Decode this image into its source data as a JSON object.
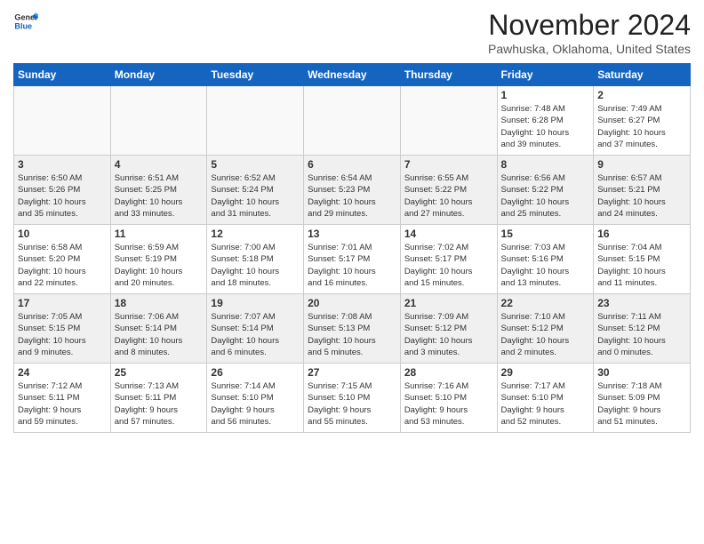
{
  "header": {
    "logo_general": "General",
    "logo_blue": "Blue",
    "title": "November 2024",
    "location": "Pawhuska, Oklahoma, United States"
  },
  "weekdays": [
    "Sunday",
    "Monday",
    "Tuesday",
    "Wednesday",
    "Thursday",
    "Friday",
    "Saturday"
  ],
  "weeks": [
    [
      {
        "day": "",
        "info": ""
      },
      {
        "day": "",
        "info": ""
      },
      {
        "day": "",
        "info": ""
      },
      {
        "day": "",
        "info": ""
      },
      {
        "day": "",
        "info": ""
      },
      {
        "day": "1",
        "info": "Sunrise: 7:48 AM\nSunset: 6:28 PM\nDaylight: 10 hours\nand 39 minutes."
      },
      {
        "day": "2",
        "info": "Sunrise: 7:49 AM\nSunset: 6:27 PM\nDaylight: 10 hours\nand 37 minutes."
      }
    ],
    [
      {
        "day": "3",
        "info": "Sunrise: 6:50 AM\nSunset: 5:26 PM\nDaylight: 10 hours\nand 35 minutes."
      },
      {
        "day": "4",
        "info": "Sunrise: 6:51 AM\nSunset: 5:25 PM\nDaylight: 10 hours\nand 33 minutes."
      },
      {
        "day": "5",
        "info": "Sunrise: 6:52 AM\nSunset: 5:24 PM\nDaylight: 10 hours\nand 31 minutes."
      },
      {
        "day": "6",
        "info": "Sunrise: 6:54 AM\nSunset: 5:23 PM\nDaylight: 10 hours\nand 29 minutes."
      },
      {
        "day": "7",
        "info": "Sunrise: 6:55 AM\nSunset: 5:22 PM\nDaylight: 10 hours\nand 27 minutes."
      },
      {
        "day": "8",
        "info": "Sunrise: 6:56 AM\nSunset: 5:22 PM\nDaylight: 10 hours\nand 25 minutes."
      },
      {
        "day": "9",
        "info": "Sunrise: 6:57 AM\nSunset: 5:21 PM\nDaylight: 10 hours\nand 24 minutes."
      }
    ],
    [
      {
        "day": "10",
        "info": "Sunrise: 6:58 AM\nSunset: 5:20 PM\nDaylight: 10 hours\nand 22 minutes."
      },
      {
        "day": "11",
        "info": "Sunrise: 6:59 AM\nSunset: 5:19 PM\nDaylight: 10 hours\nand 20 minutes."
      },
      {
        "day": "12",
        "info": "Sunrise: 7:00 AM\nSunset: 5:18 PM\nDaylight: 10 hours\nand 18 minutes."
      },
      {
        "day": "13",
        "info": "Sunrise: 7:01 AM\nSunset: 5:17 PM\nDaylight: 10 hours\nand 16 minutes."
      },
      {
        "day": "14",
        "info": "Sunrise: 7:02 AM\nSunset: 5:17 PM\nDaylight: 10 hours\nand 15 minutes."
      },
      {
        "day": "15",
        "info": "Sunrise: 7:03 AM\nSunset: 5:16 PM\nDaylight: 10 hours\nand 13 minutes."
      },
      {
        "day": "16",
        "info": "Sunrise: 7:04 AM\nSunset: 5:15 PM\nDaylight: 10 hours\nand 11 minutes."
      }
    ],
    [
      {
        "day": "17",
        "info": "Sunrise: 7:05 AM\nSunset: 5:15 PM\nDaylight: 10 hours\nand 9 minutes."
      },
      {
        "day": "18",
        "info": "Sunrise: 7:06 AM\nSunset: 5:14 PM\nDaylight: 10 hours\nand 8 minutes."
      },
      {
        "day": "19",
        "info": "Sunrise: 7:07 AM\nSunset: 5:14 PM\nDaylight: 10 hours\nand 6 minutes."
      },
      {
        "day": "20",
        "info": "Sunrise: 7:08 AM\nSunset: 5:13 PM\nDaylight: 10 hours\nand 5 minutes."
      },
      {
        "day": "21",
        "info": "Sunrise: 7:09 AM\nSunset: 5:12 PM\nDaylight: 10 hours\nand 3 minutes."
      },
      {
        "day": "22",
        "info": "Sunrise: 7:10 AM\nSunset: 5:12 PM\nDaylight: 10 hours\nand 2 minutes."
      },
      {
        "day": "23",
        "info": "Sunrise: 7:11 AM\nSunset: 5:12 PM\nDaylight: 10 hours\nand 0 minutes."
      }
    ],
    [
      {
        "day": "24",
        "info": "Sunrise: 7:12 AM\nSunset: 5:11 PM\nDaylight: 9 hours\nand 59 minutes."
      },
      {
        "day": "25",
        "info": "Sunrise: 7:13 AM\nSunset: 5:11 PM\nDaylight: 9 hours\nand 57 minutes."
      },
      {
        "day": "26",
        "info": "Sunrise: 7:14 AM\nSunset: 5:10 PM\nDaylight: 9 hours\nand 56 minutes."
      },
      {
        "day": "27",
        "info": "Sunrise: 7:15 AM\nSunset: 5:10 PM\nDaylight: 9 hours\nand 55 minutes."
      },
      {
        "day": "28",
        "info": "Sunrise: 7:16 AM\nSunset: 5:10 PM\nDaylight: 9 hours\nand 53 minutes."
      },
      {
        "day": "29",
        "info": "Sunrise: 7:17 AM\nSunset: 5:10 PM\nDaylight: 9 hours\nand 52 minutes."
      },
      {
        "day": "30",
        "info": "Sunrise: 7:18 AM\nSunset: 5:09 PM\nDaylight: 9 hours\nand 51 minutes."
      }
    ]
  ]
}
